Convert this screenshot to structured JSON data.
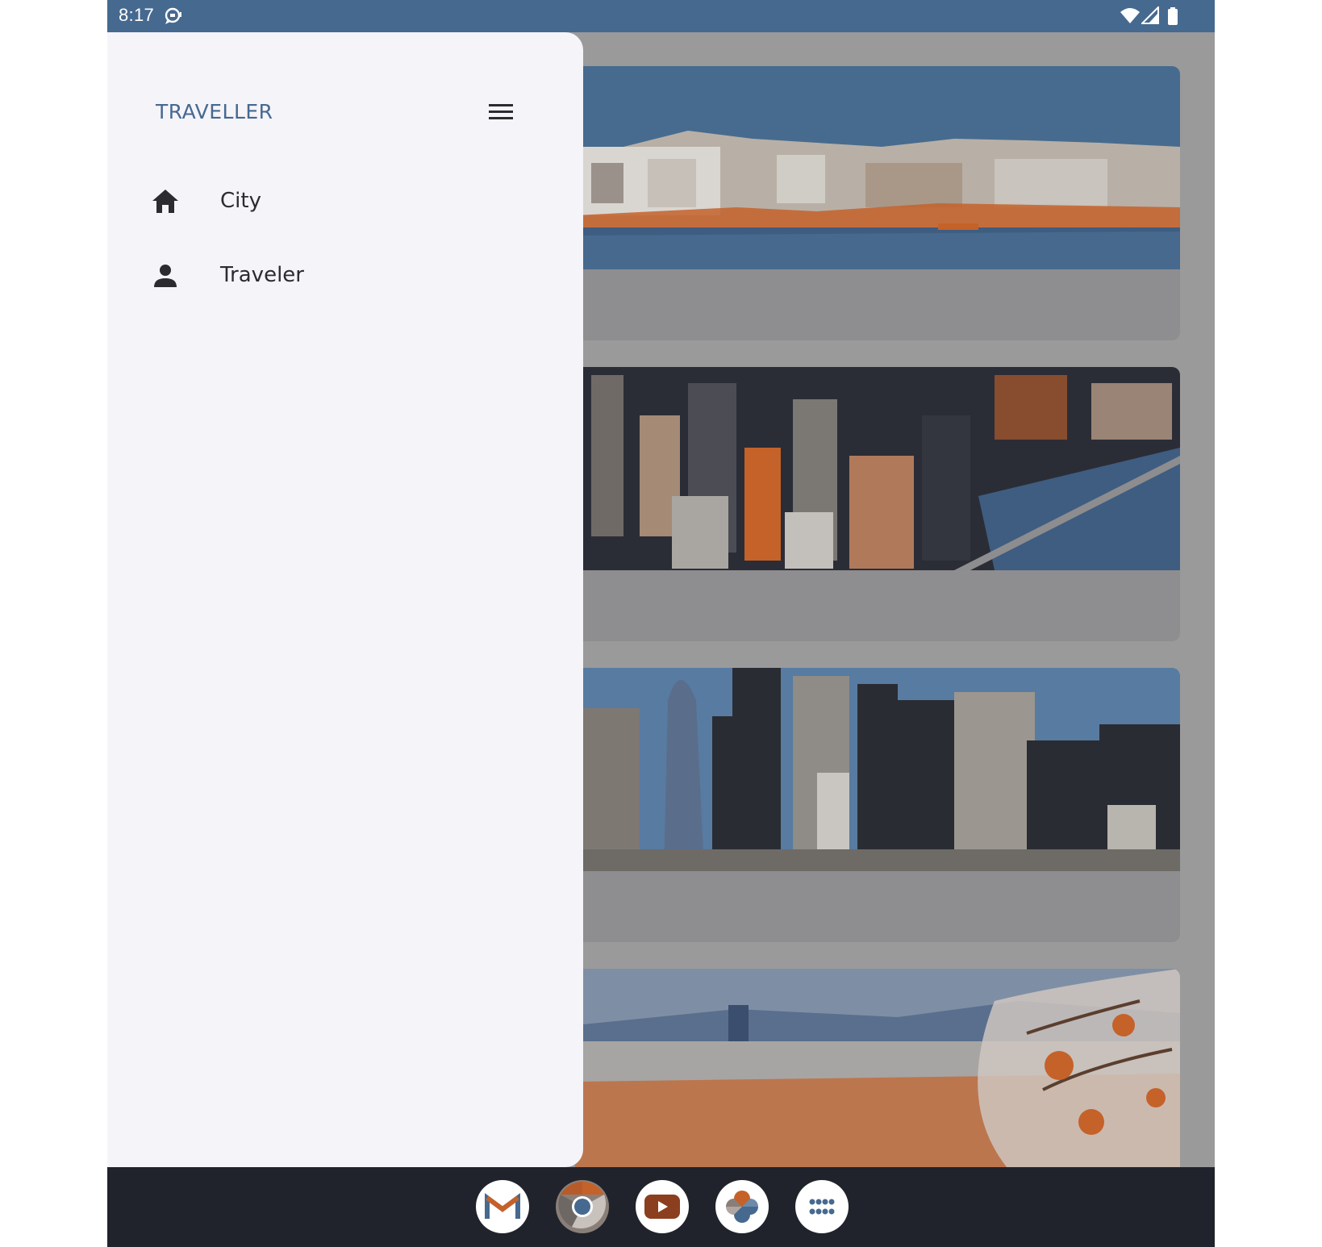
{
  "status_bar": {
    "time": "8:17",
    "icons": [
      "chat-notification-icon",
      "wifi-icon",
      "cell-signal-icon",
      "battery-icon"
    ]
  },
  "drawer": {
    "title": "TRAVELLER",
    "menu_icon": "hamburger-menu-icon",
    "items": [
      {
        "label": "City",
        "icon": "home-icon"
      },
      {
        "label": "Traveler",
        "icon": "person-icon"
      }
    ]
  },
  "cards": [
    {
      "image": "coastal-town-photo"
    },
    {
      "image": "city-skyline-aerial-photo"
    },
    {
      "image": "downtown-skyscrapers-photo"
    },
    {
      "image": "city-with-blossoms-photo"
    }
  ],
  "dock": {
    "apps": [
      {
        "name": "Gmail",
        "icon": "gmail-icon"
      },
      {
        "name": "Chrome",
        "icon": "chrome-icon"
      },
      {
        "name": "YouTube",
        "icon": "youtube-icon"
      },
      {
        "name": "Photos",
        "icon": "photos-icon"
      },
      {
        "name": "App drawer",
        "icon": "apps-grid-icon"
      }
    ]
  },
  "colors": {
    "primary": "#46698f",
    "drawer_bg": "#f5f4f9",
    "scrim": "#9a9a9b",
    "dock_bg": "#20232b",
    "accent_orange": "#c4622a"
  }
}
